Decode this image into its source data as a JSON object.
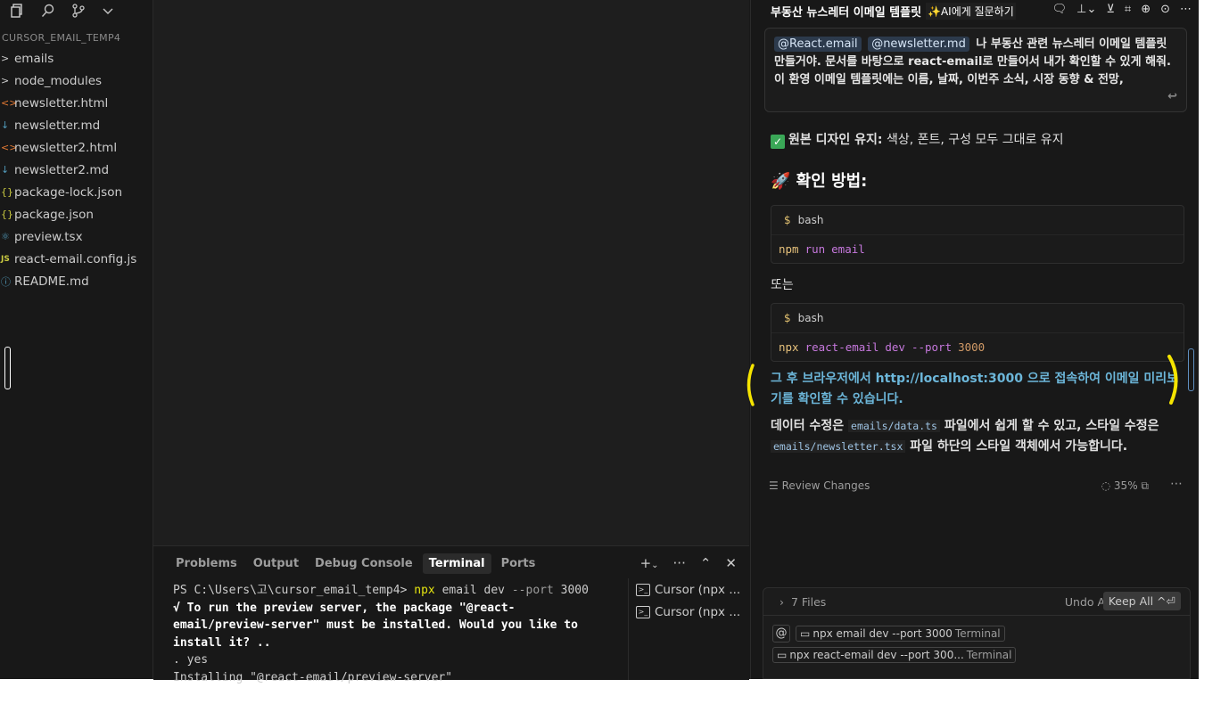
{
  "sidebar": {
    "project_title": "CURSOR_EMAIL_TEMP4",
    "items": [
      {
        "icon": ">",
        "icon_color": "#cccccc",
        "label": "emails"
      },
      {
        "icon": ">",
        "icon_color": "#cccccc",
        "label": "node_modules"
      },
      {
        "icon": "<>",
        "icon_color": "#e37933",
        "label": "newsletter.html"
      },
      {
        "icon": "↓",
        "icon_color": "#519aba",
        "label": "newsletter.md"
      },
      {
        "icon": "<>",
        "icon_color": "#e37933",
        "label": "newsletter2.html"
      },
      {
        "icon": "↓",
        "icon_color": "#519aba",
        "label": "newsletter2.md"
      },
      {
        "icon": "{}",
        "icon_color": "#cbcb41",
        "label": "package-lock.json"
      },
      {
        "icon": "{}",
        "icon_color": "#cbcb41",
        "label": "package.json"
      },
      {
        "icon": "⚛",
        "icon_color": "#519aba",
        "label": "preview.tsx"
      },
      {
        "icon": "JS",
        "icon_color": "#cbcb41",
        "label": "react-email.config.js"
      },
      {
        "icon": "ⓘ",
        "icon_color": "#519aba",
        "label": "README.md"
      }
    ]
  },
  "panel": {
    "tabs": [
      "Problems",
      "Output",
      "Debug Console",
      "Terminal",
      "Ports"
    ],
    "active_tab": "Terminal",
    "terminal": {
      "prompt": "PS C:\\Users\\고\\cursor_email_temp4>",
      "cmd_name": "npx",
      "cmd_arg1": "email",
      "cmd_arg2": "dev",
      "cmd_flag": "--port",
      "cmd_port": "3000",
      "line2": "√ To run the preview server, the package \"@react-email/preview-server\" must be installed. Would you like to install it? ..",
      "line3": ". yes",
      "line4": "Installing \"@react-email/preview-server\""
    },
    "terminal_list": [
      "Cursor (npx ...",
      "Cursor (npx ..."
    ]
  },
  "chat": {
    "title": "부동산 뉴스레터 이메일 템플릿",
    "ask_ai": "AI에게 질문하기",
    "prompt": {
      "mention1": "@React.email",
      "mention2": "@newsletter.md",
      "text": "나 부동산 관련 뉴스레터 이메일 템플릿 만들거야. 문서를 바탕으로 react-email로 만들어서 내가 확인할 수 있게 해줘. 이 환영 이메일 템플릿에는 이름, 날짜, 이번주 소식, 시장 동향 & 전망,"
    },
    "check_bold": "원본 디자인 유지:",
    "check_rest": " 색상, 폰트, 구성 모두 그대로 유지",
    "heading": "🚀 확인 방법:",
    "code1": {
      "lang": "bash",
      "cmd": "npm",
      "a1": "run",
      "a2": "email"
    },
    "or_text": "또는",
    "code2": {
      "lang": "bash",
      "cmd": "npx",
      "a1": "react-email",
      "a2": "dev",
      "flag": "--port",
      "port": "3000"
    },
    "link_para": "그 후 브라우저에서 http://localhost:3000 으로 접속하여 이메일 미리보기를 확인할 수 있습니다.",
    "edit_p1": "데이터 수정은 ",
    "edit_code1": "emails/data.ts",
    "edit_p2": " 파일에서 쉽게 할 수 있고, 스타일 수정은 ",
    "edit_code2": "emails/newsletter.tsx",
    "edit_p3": " 파일 하단의 스타일 객체에서 가능합니다.",
    "review_label": "Review Changes",
    "review_pct": "35%",
    "files_count": "7 Files",
    "undo_all": "Undo All",
    "keep_all": "Keep All ^⏎",
    "ctx1_label": "npx email dev --port 3000",
    "ctx1_sub": "Terminal",
    "ctx2_label": "npx react-email dev --port 300...",
    "ctx2_sub": "Terminal"
  },
  "colors": {
    "annotation": "#f5e400",
    "link": "#6cb6d9"
  }
}
